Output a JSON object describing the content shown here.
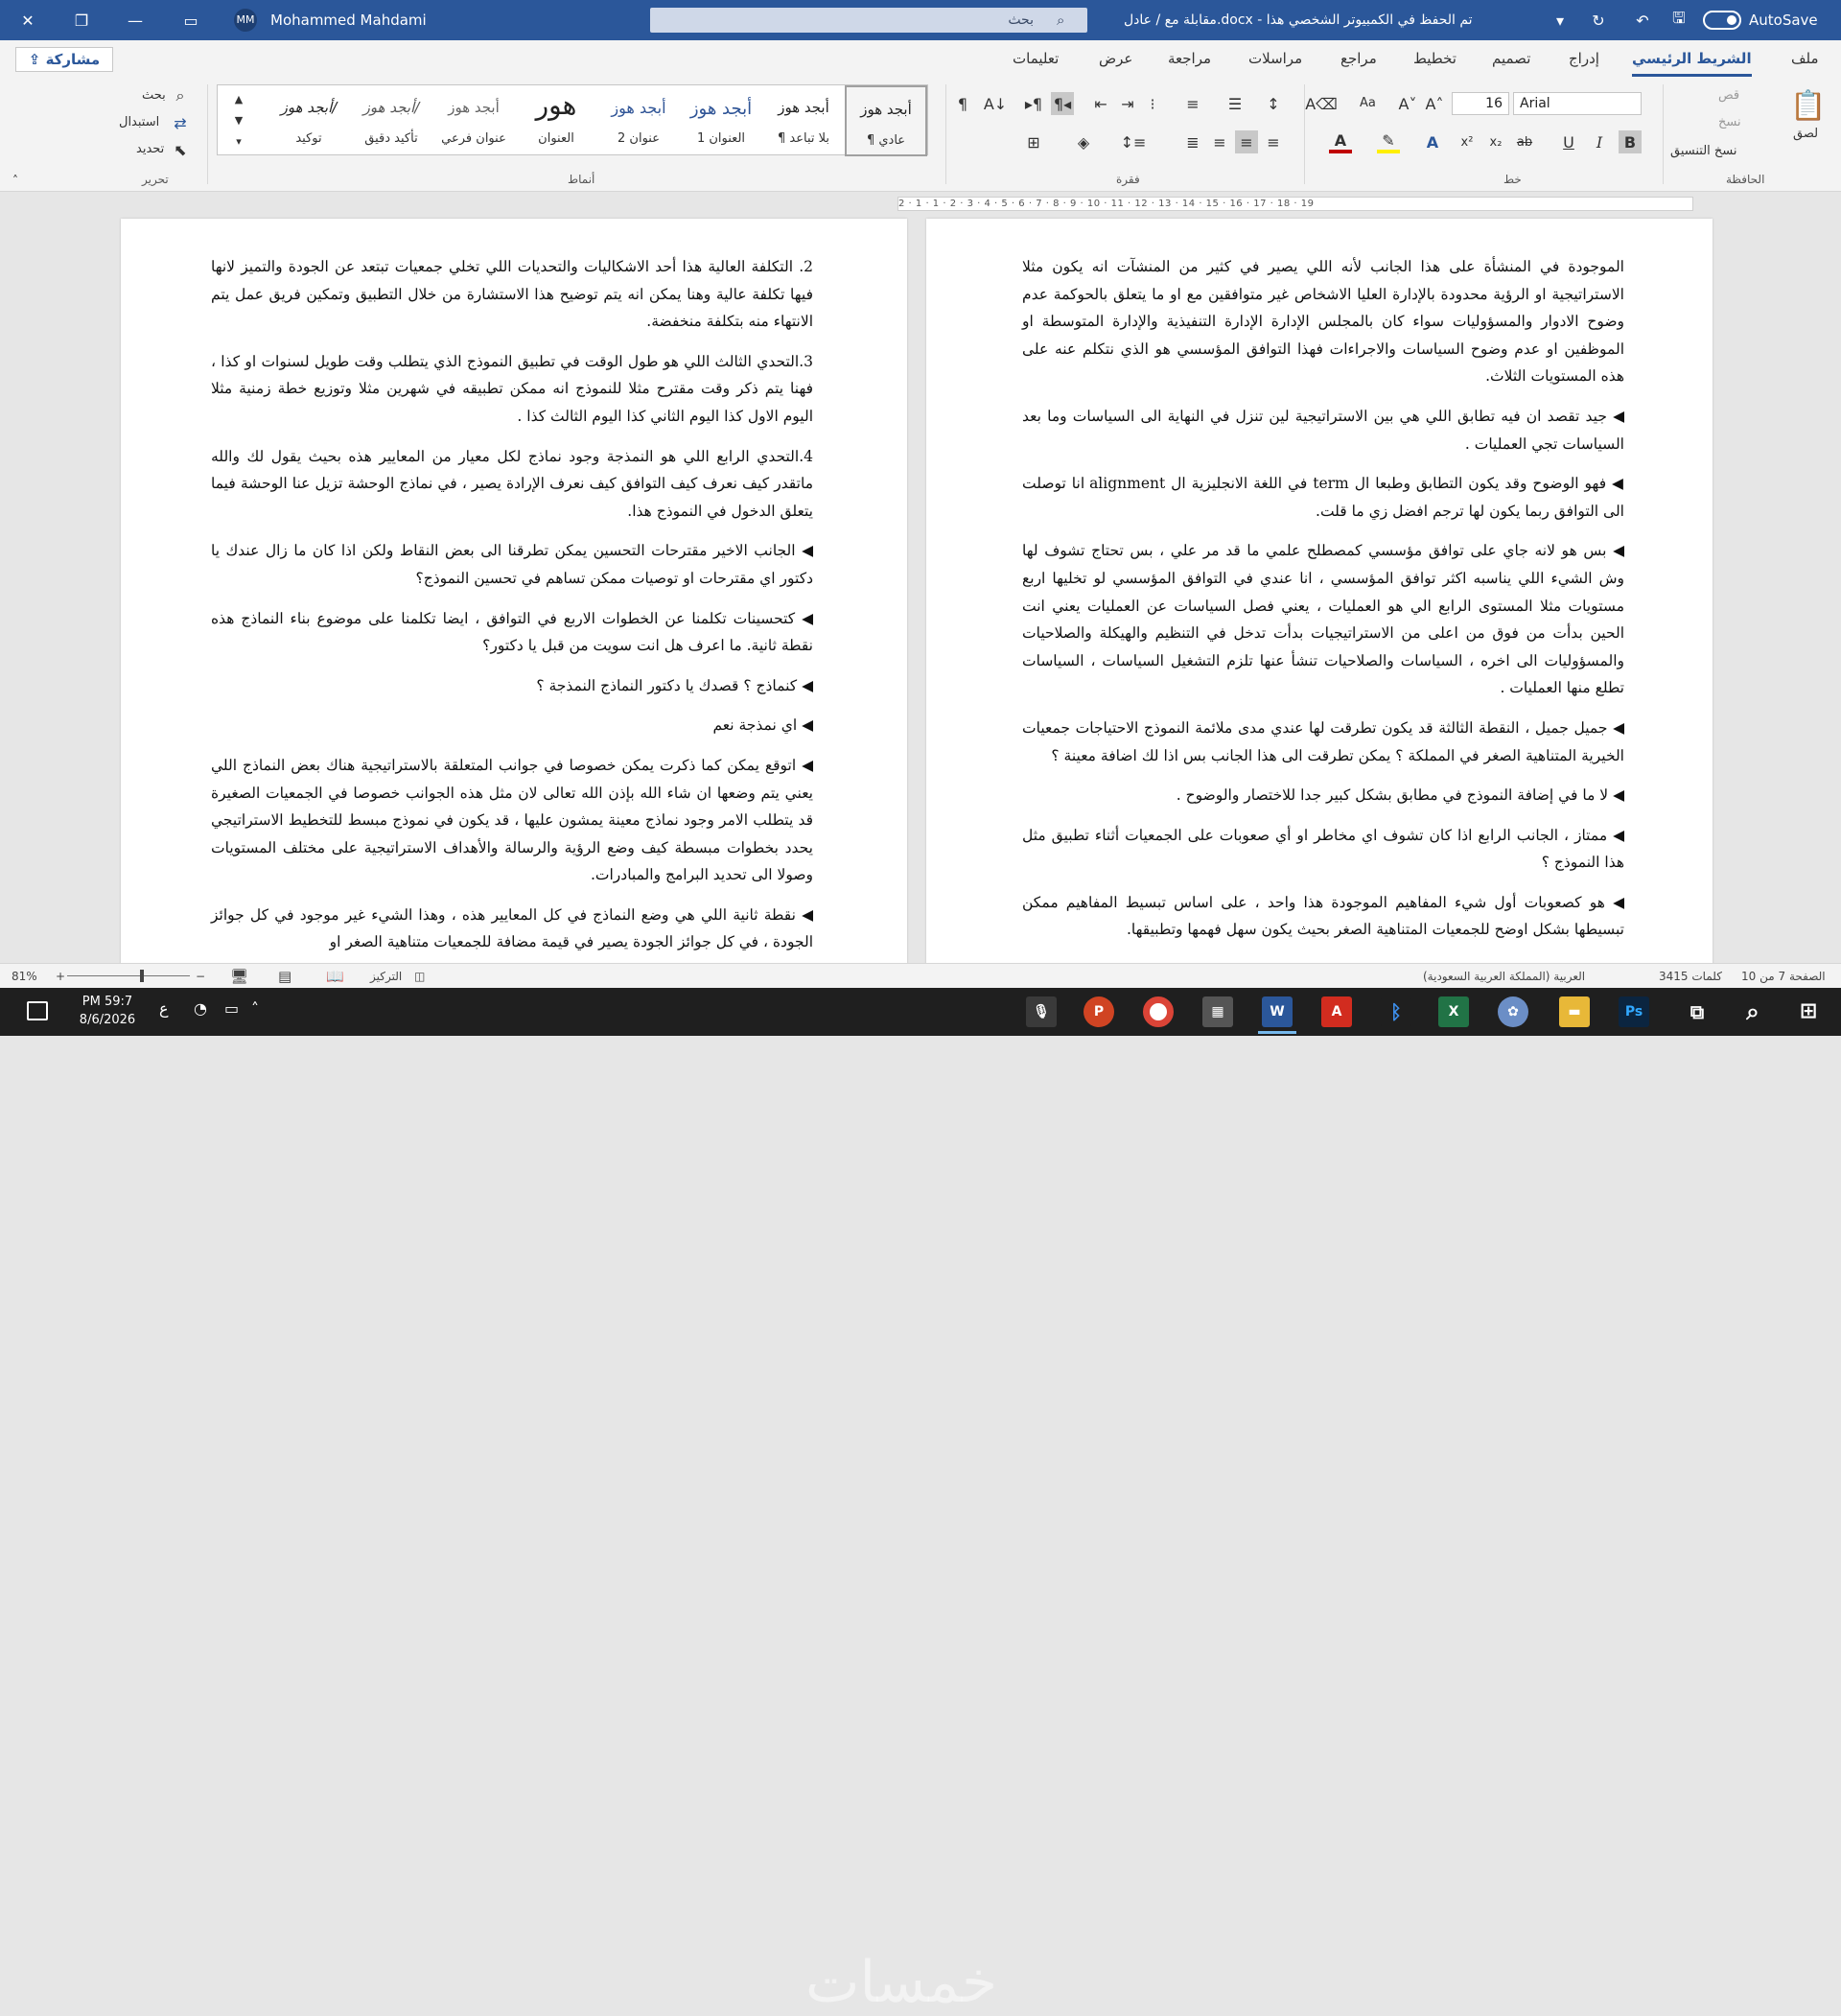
{
  "titlebar": {
    "autosave_label": "AutoSave",
    "document_title": "مقابلة مع / عادل.docx  -  تم الحفظ في الكمبيوتر الشخصي هذا",
    "search_placeholder": "بحث",
    "user_name": "Mohammed Mahdami",
    "user_initials": "MM"
  },
  "tabs": [
    "ملف",
    "الشريط الرئيسي",
    "إدراج",
    "تصميم",
    "تخطيط",
    "مراجع",
    "مراسلات",
    "مراجعة",
    "عرض",
    "تعليمات"
  ],
  "active_tab": "الشريط الرئيسي",
  "share_label": "مشاركة",
  "ribbon": {
    "clipboard": {
      "group": "الحافظة",
      "paste": "لصق",
      "cut": "قص",
      "copy": "نسخ",
      "format_painter": "نسخ التنسيق"
    },
    "font": {
      "group": "خط",
      "font_name": "Arial",
      "font_size": "16",
      "bold": "B",
      "italic": "I",
      "underline": "U",
      "strike": "ab",
      "subscript": "x₂",
      "superscript": "x²",
      "case": "Aa"
    },
    "paragraph": {
      "group": "فقرة"
    },
    "styles": {
      "group": "أنماط",
      "items": [
        {
          "sample": "أبجد هوز",
          "name": "¶ عادي"
        },
        {
          "sample": "أبجد هوز",
          "name": "¶ بلا تباعد"
        },
        {
          "sample": "أبجد هوز",
          "name": "العنوان 1"
        },
        {
          "sample": "أبجد هوز",
          "name": "عنوان 2"
        },
        {
          "sample": "هور",
          "name": "العنوان"
        },
        {
          "sample": "أبجد هوز",
          "name": "عنوان فرعي"
        },
        {
          "sample": "أبجد هوز/",
          "name": "تأكيد دقيق"
        },
        {
          "sample": "أبجد هوز/",
          "name": "توكيد"
        }
      ]
    },
    "editing": {
      "group": "تحرير",
      "find": "بحث",
      "replace": "استبدال",
      "select": "تحديد"
    }
  },
  "ruler": "2 · 1 · 1 · 2 · 3 · 4 · 5 · 6 · 7 · 8 · 9 · 10 · 11 · 12 · 13 · 14 · 15 · 16 · 17 · 18 · 19",
  "pages": {
    "right": [
      "الموجودة في المنشأة على هذا الجانب لأنه اللي يصير في كثير من المنشآت انه يكون مثلا الاستراتيجية او الرؤية محدودة بالإدارة العليا الاشخاص غير متوافقين مع او ما يتعلق بالحوكمة عدم وضوح الادوار والمسؤوليات سواء كان بالمجلس الإدارة الإدارة التنفيذية والإدارة المتوسطة او الموظفين او عدم وضوح السياسات والاجراءات فهذا التوافق المؤسسي هو الذي نتكلم عنه على هذه المستويات الثلاث.",
      "◀ جيد تقصد ان فيه تطابق اللي هي بين الاستراتيجية لين تنزل في النهاية الى السياسات وما بعد السياسات تجي العمليات .",
      "◀ فهو الوضوح وقد يكون التطابق وطبعا ال term في اللغة الانجليزية ال alignment انا توصلت الى التوافق ربما يكون لها ترجم افضل زي ما قلت.",
      "◀ بس هو لانه جاي على توافق مؤسسي كمصطلح علمي ما قد مر علي ، بس تحتاج تشوف لها وش الشيء اللي يناسبه اكثر توافق المؤسسي ، انا عندي في التوافق المؤسسي لو تخليها اربع مستويات مثلا المستوى الرابع الي هو العمليات ، يعني فصل السياسات عن العمليات يعني انت الحين بدأت من فوق من اعلى من الاستراتيجيات بدأت تدخل في التنظيم والهيكلة والصلاحيات والمسؤوليات الى اخره ، السياسات والصلاحيات تنشأ عنها تلزم التشغيل السياسات ، السياسات تطلع منها العمليات .",
      "◀ جميل جميل ، النقطة الثالثة قد يكون تطرقت لها عندي مدى ملائمة النموذج الاحتياجات جمعيات الخيرية المتناهية الصغر في المملكة ؟ يمكن تطرقت الى هذا الجانب بس اذا لك اضافة معينة ؟",
      "◀ لا ما في إضافة النموذج في مطابق بشكل كبير جدا للاختصار والوضوح .",
      "◀ ممتاز ، الجانب الرابع اذا كان تشوف اي مخاطر او أي صعوبات على الجمعيات أثناء تطبيق مثل هذا النموذج ؟",
      "◀ هو كصعوبات أول شيء المفاهيم الموجودة هذا واحد ، على اساس تبسيط المفاهيم ممكن تبسيطها بشكل اوضح للجمعيات المتناهية الصغر بحيث يكون سهل فهمها وتطبيقها."
    ],
    "left": [
      "2. التكلفة العالية هذا أحد الاشكاليات والتحديات اللي تخلي جمعيات تبتعد عن الجودة والتميز لانها فيها تكلفة عالية وهنا يمكن انه يتم توضيح هذا الاستشارة من خلال التطبيق وتمكين فريق عمل يتم الانتهاء منه بتكلفة منخفضة.",
      "3.التحدي الثالث اللي هو طول الوقت في تطبيق النموذج الذي يتطلب وقت طويل لسنوات او كذا ، فهنا يتم ذكر وقت مقترح مثلا للنموذج انه ممكن تطبيقه في شهرين مثلا وتوزيع خطة زمنية مثلا اليوم الاول كذا اليوم الثاني كذا اليوم الثالث كذا .",
      "4.التحدي الرابع اللي هو النمذجة وجود نماذج لكل معيار من المعايير هذه بحيث يقول لك والله ماتقدر كيف نعرف كيف التوافق كيف نعرف الإرادة يصير ، في نماذج الوحشة تزيل عنا الوحشة فيما يتعلق الدخول في النموذج هذا.",
      "◀ الجانب الاخير مقترحات التحسين يمكن تطرقنا الى بعض النقاط ولكن اذا كان ما زال عندك يا دكتور اي مقترحات او توصيات ممكن تساهم في تحسين النموذج؟",
      "◀ كتحسينات تكلمنا عن الخطوات الاربع في التوافق ، ايضا تكلمنا على موضوع بناء النماذج هذه نقطة ثانية. ما اعرف هل انت سويت من قبل يا دكتور؟",
      "◀ كنماذج ؟ قصدك يا دكتور النماذج النمذجة ؟",
      "◀ اي نمذجة نعم",
      "◀ اتوقع يمكن كما ذكرت يمكن خصوصا في جوانب المتعلقة بالاستراتيجية هناك بعض النماذج اللي يعني يتم وضعها ان شاء الله بإذن الله تعالى لان مثل هذه الجوانب خصوصا في الجمعيات الصغيرة قد يتطلب الامر وجود نماذج معينة يمشون عليها ، قد يكون في نموذج مبسط للتخطيط الاستراتيجي يحدد بخطوات مبسطة كيف وضع الرؤية والرسالة والأهداف الاستراتيجية على مختلف المستويات وصولا الى تحديد البرامج والمبادرات.",
      "◀ نقطة ثانية اللي هي وضع النماذج في كل المعايير هذه ، وهذا الشيء غير موجود في كل جوائز الجودة ، في كل جوائز الجودة يصير في قيمة مضافة للجمعيات متناهية الصغر او"
    ]
  },
  "statusbar": {
    "page": "الصفحة 7 من 10",
    "words": "3415 كلمات",
    "language": "العربية (المملكة العربية السعودية)",
    "focus": "التركيز",
    "zoom": "81%"
  },
  "taskbar": {
    "time": "PM 59:7",
    "date": "8/6/2026",
    "lang": "ع",
    "watermark": "خمسات"
  }
}
